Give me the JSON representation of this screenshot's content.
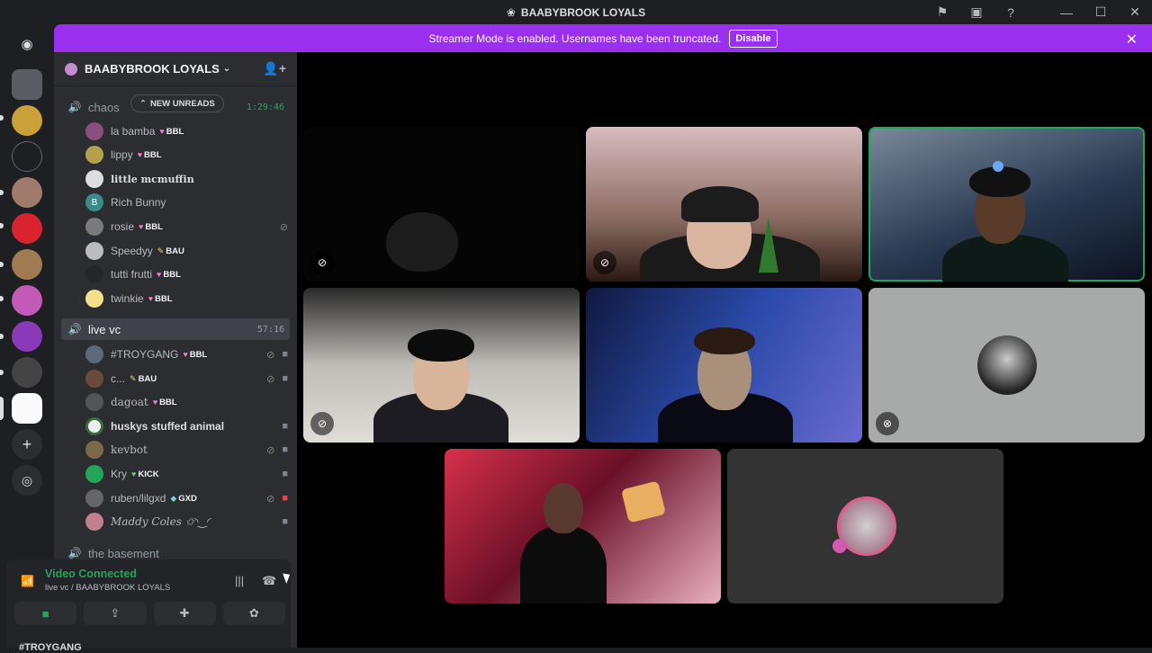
{
  "window": {
    "title": "BAABYBROOK LOYALS"
  },
  "banner": {
    "text": "Streamer Mode is enabled. Usernames have been truncated.",
    "button": "Disable"
  },
  "server": {
    "name": "BAABYBROOK LOYALS"
  },
  "channels": {
    "chaos": {
      "name": "chaos",
      "timer": "1:29:46",
      "new_unreads": "NEW UNREADS"
    },
    "live_vc": {
      "name": "live vc",
      "timer": "57:16"
    },
    "basement": {
      "name": "the basement"
    }
  },
  "chaos_users": [
    {
      "name": "la bamba",
      "badge": "BBL"
    },
    {
      "name": "lippy",
      "badge": "BBL"
    },
    {
      "name": "little mcmuffin",
      "badge": ""
    },
    {
      "name": "Rich Bunny",
      "badge": ""
    },
    {
      "name": "rosie",
      "badge": "BBL"
    },
    {
      "name": "Speedyy",
      "badge": "BAU"
    },
    {
      "name": "tutti frutti",
      "badge": "BBL"
    },
    {
      "name": "twinkie",
      "badge": "BBL"
    }
  ],
  "live_users": [
    {
      "name": "#TROYGANG",
      "badge": "BBL"
    },
    {
      "name": "c...",
      "badge": "BAU"
    },
    {
      "name": "dagoat",
      "badge": "BBL"
    },
    {
      "name": "huskys stuffed animal",
      "badge": ""
    },
    {
      "name": "kevbot",
      "badge": ""
    },
    {
      "name": "Kry",
      "badge": "KICK"
    },
    {
      "name": "ruben/lilgxd",
      "badge": "GXD"
    },
    {
      "name": "𝑀𝑎𝑑𝑑𝑦 𝐶𝑜𝑙𝑒𝑠 ✩◝‿◜",
      "badge": ""
    }
  ],
  "voice_panel": {
    "status": "Video Connected",
    "location": "live vc / BAABYBROOK LOYALS",
    "next_item": "#TROYGANG"
  },
  "colors": {
    "accent": "#9b2ff0",
    "green": "#23a55a",
    "bg": "#1e1f22",
    "sidebar": "#2b2d31"
  },
  "icons": [
    "discord-logo-icon",
    "flag-icon",
    "screen-icon",
    "help-icon",
    "minimize-icon",
    "maximize-icon",
    "close-icon",
    "add-member-icon",
    "speaker-icon",
    "mic-off-icon",
    "camera-icon",
    "share-screen-icon",
    "activity-icon",
    "soundboard-icon",
    "disconnect-icon",
    "signal-icon"
  ]
}
